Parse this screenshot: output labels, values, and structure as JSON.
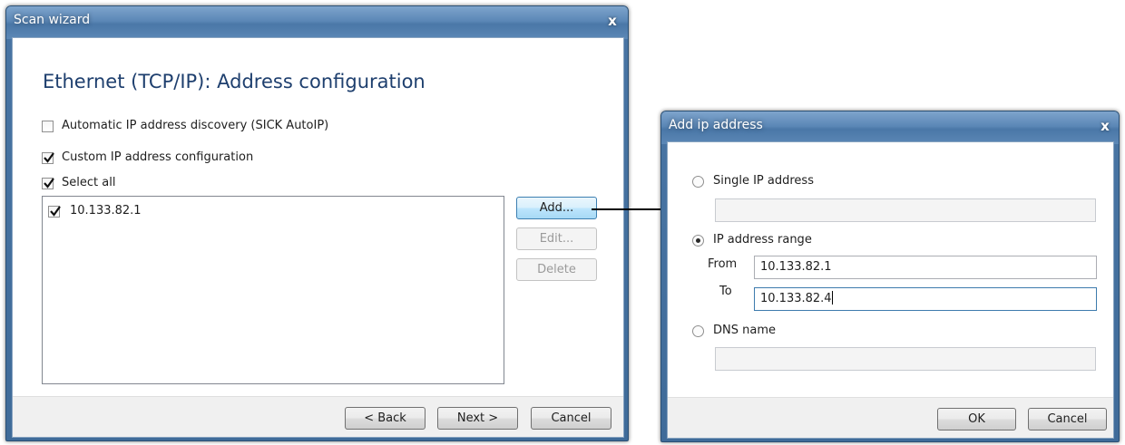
{
  "scan_wizard": {
    "title": "Scan wizard",
    "close_glyph": "x",
    "heading": "Ethernet (TCP/IP): Address configuration",
    "auto_ip": {
      "label": "Automatic IP address discovery (SICK AutoIP)",
      "checked": false
    },
    "custom_ip": {
      "label": "Custom IP address configuration",
      "checked": true
    },
    "select_all": {
      "label": "Select all",
      "checked": true
    },
    "ip_list": [
      {
        "address": "10.133.82.1",
        "checked": true
      }
    ],
    "buttons": {
      "add": "Add...",
      "edit": "Edit...",
      "delete": "Delete"
    },
    "footer": {
      "back": "< Back",
      "next": "Next >",
      "cancel": "Cancel"
    }
  },
  "add_ip_dialog": {
    "title": "Add ip address",
    "close_glyph": "x",
    "single_ip": {
      "label": "Single IP address",
      "selected": false,
      "value": ""
    },
    "ip_range": {
      "label": "IP address range",
      "selected": true,
      "from_label": "From",
      "from_value": "10.133.82.1",
      "to_label": "To",
      "to_value": "10.133.82.4"
    },
    "dns": {
      "label": "DNS name",
      "selected": false,
      "value": ""
    },
    "buttons": {
      "ok": "OK",
      "cancel": "Cancel"
    }
  },
  "colors": {
    "title_bar": "#4a77a7",
    "accent_border": "#3d7bad",
    "heading_text": "#1e3f6e"
  },
  "icons": {
    "arrow": "arrow-right-icon",
    "check": "check-icon"
  }
}
